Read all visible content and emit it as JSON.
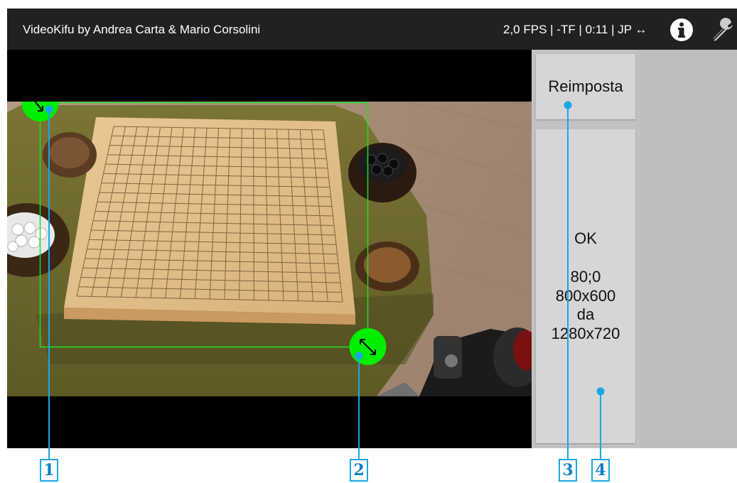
{
  "appbar": {
    "title": "VideoKifu by Andrea Carta & Mario Corsolini",
    "status": "2,0 FPS | -TF | 0:11 | JP ↔",
    "info_icon": "info-icon",
    "settings_icon": "wrench-icon"
  },
  "panel": {
    "reset_label": "Reimposta",
    "ok_label": "OK",
    "ok_details": [
      "80;0",
      "800x600",
      "da",
      "1280x720"
    ]
  },
  "callouts": [
    "1",
    "2",
    "3",
    "4"
  ],
  "colors": {
    "appbar": "#212121",
    "handle": "#00ee00",
    "selection": "#22dd22",
    "callout": "#1aa6e6"
  }
}
